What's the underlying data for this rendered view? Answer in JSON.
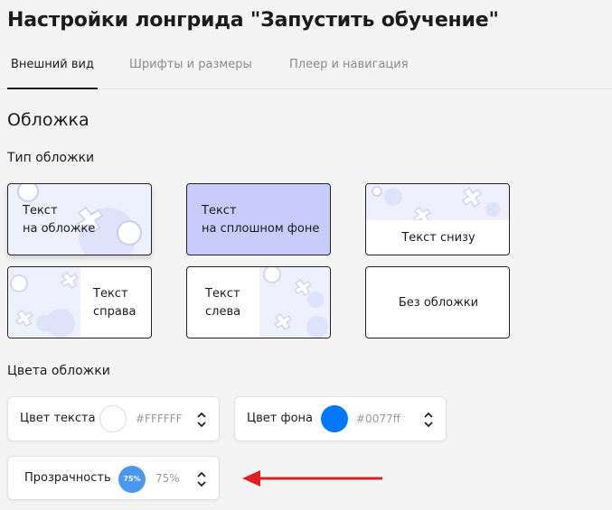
{
  "page_title": "Настройки лонгрида \"Запустить обучение\"",
  "tabs": [
    {
      "label": "Внешний вид",
      "active": true
    },
    {
      "label": "Шрифты и размеры",
      "active": false
    },
    {
      "label": "Плеер и навигация",
      "active": false
    }
  ],
  "cover": {
    "section_title": "Обложка",
    "type_label": "Тип обложки",
    "types": {
      "on_cover": [
        "Текст",
        "на обложке"
      ],
      "solid_bg": [
        "Текст",
        "на сплошном фоне"
      ],
      "below": "Текст снизу",
      "right": [
        "Текст",
        "справа"
      ],
      "left": [
        "Текст",
        "слева"
      ],
      "none": "Без обложки"
    },
    "colors_label": "Цвета обложки",
    "text_color": {
      "label": "Цвет текста",
      "value": "#FFFFFF"
    },
    "bg_color": {
      "label": "Цвет фона",
      "value": "#0077ff"
    },
    "opacity": {
      "label": "Прозрачность",
      "badge": "75%",
      "value": "75%"
    }
  },
  "colors": {
    "solid_bg": "#c7ccfa",
    "deco": "#dfe2fb",
    "bg_swatch": "#0077ff",
    "opacity_badge": "#4a97f0",
    "arrow": "#e02020"
  }
}
